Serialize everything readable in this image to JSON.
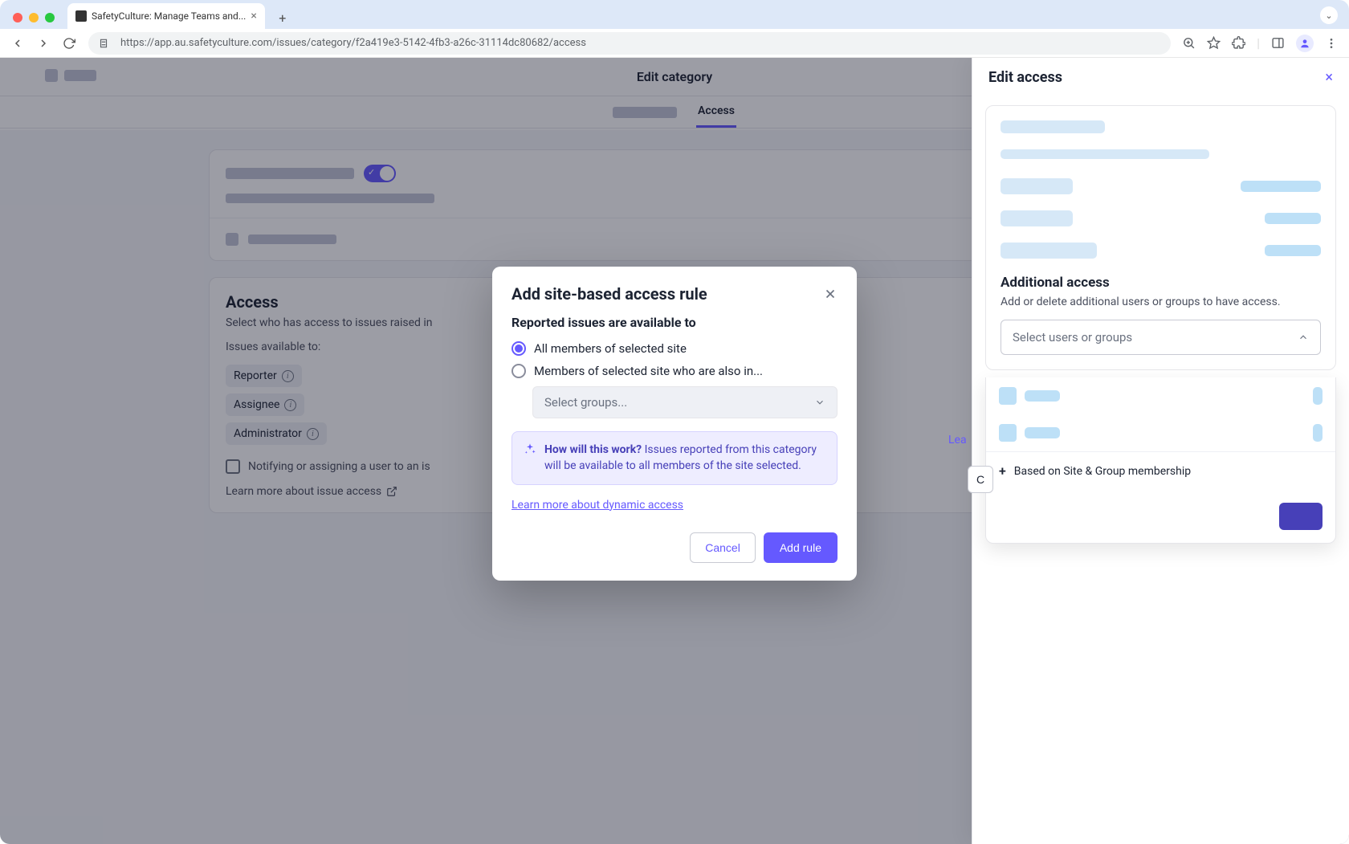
{
  "browser": {
    "tab_title": "SafetyCulture: Manage Teams and...",
    "url": "https://app.au.safetyculture.com/issues/category/f2a419e3-5142-4fb3-a26c-31114dc80682/access"
  },
  "header": {
    "title": "Edit category",
    "tabs": {
      "active": "Access"
    }
  },
  "access_section": {
    "heading": "Access",
    "subtext": "Select who has access to issues raised in",
    "available_label": "Issues available to:",
    "chips": {
      "reporter": "Reporter",
      "assignee": "Assignee",
      "administrator": "Administrator"
    },
    "notify_text": "Notifying or assigning a user to an is",
    "learn_more": "Learn more about issue access"
  },
  "right_panel": {
    "title": "Edit access",
    "additional_heading": "Additional access",
    "additional_sub": "Add or delete additional users or groups to have access.",
    "select_placeholder": "Select users or groups",
    "site_option": "Based on Site & Group membership",
    "lea": "Lea",
    "cancel_partial": "C"
  },
  "modal": {
    "title": "Add site-based access rule",
    "subtitle": "Reported issues are available to",
    "option1": "All members of selected site",
    "option2": "Members of selected site who are also in...",
    "select_placeholder": "Select groups...",
    "info_lead": "How will this work?",
    "info_body": "Issues reported from this category will be available to all members of the site selected.",
    "learn_link": "Learn more about dynamic access",
    "cancel": "Cancel",
    "add": "Add rule"
  }
}
